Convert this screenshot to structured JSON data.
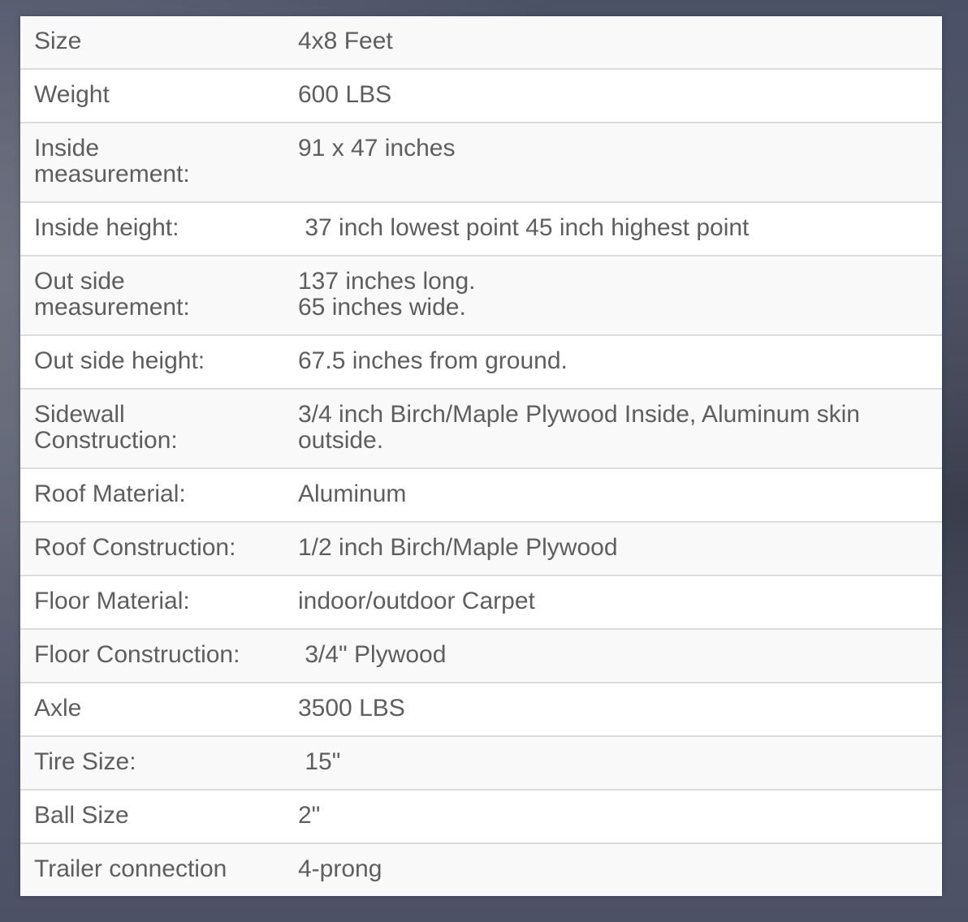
{
  "specs": [
    {
      "label": "Size",
      "value": "4x8 Feet"
    },
    {
      "label": "Weight",
      "value": "600 LBS"
    },
    {
      "label": "Inside\nmeasurement:",
      "value": "91 x 47 inches"
    },
    {
      "label": "Inside height:",
      "value": " 37 inch lowest point 45 inch highest point"
    },
    {
      "label": "Out side\nmeasurement:",
      "value": "137 inches long.\n65 inches wide."
    },
    {
      "label": "Out side height:",
      "value": "67.5 inches from ground."
    },
    {
      "label": "Sidewall\nConstruction:",
      "value": "3/4 inch Birch/Maple Plywood Inside, Aluminum skin\noutside."
    },
    {
      "label": "Roof Material:",
      "value": "Aluminum"
    },
    {
      "label": "Roof Construction:",
      "value": "1/2 inch Birch/Maple Plywood"
    },
    {
      "label": "Floor Material:",
      "value": "indoor/outdoor Carpet"
    },
    {
      "label": "Floor Construction:",
      "value": " 3/4\" Plywood"
    },
    {
      "label": "Axle",
      "value": "3500 LBS"
    },
    {
      "label": "Tire Size:",
      "value": " 15\""
    },
    {
      "label": "Ball Size",
      "value": "2\""
    },
    {
      "label": "Trailer connection",
      "value": "4-prong"
    }
  ]
}
